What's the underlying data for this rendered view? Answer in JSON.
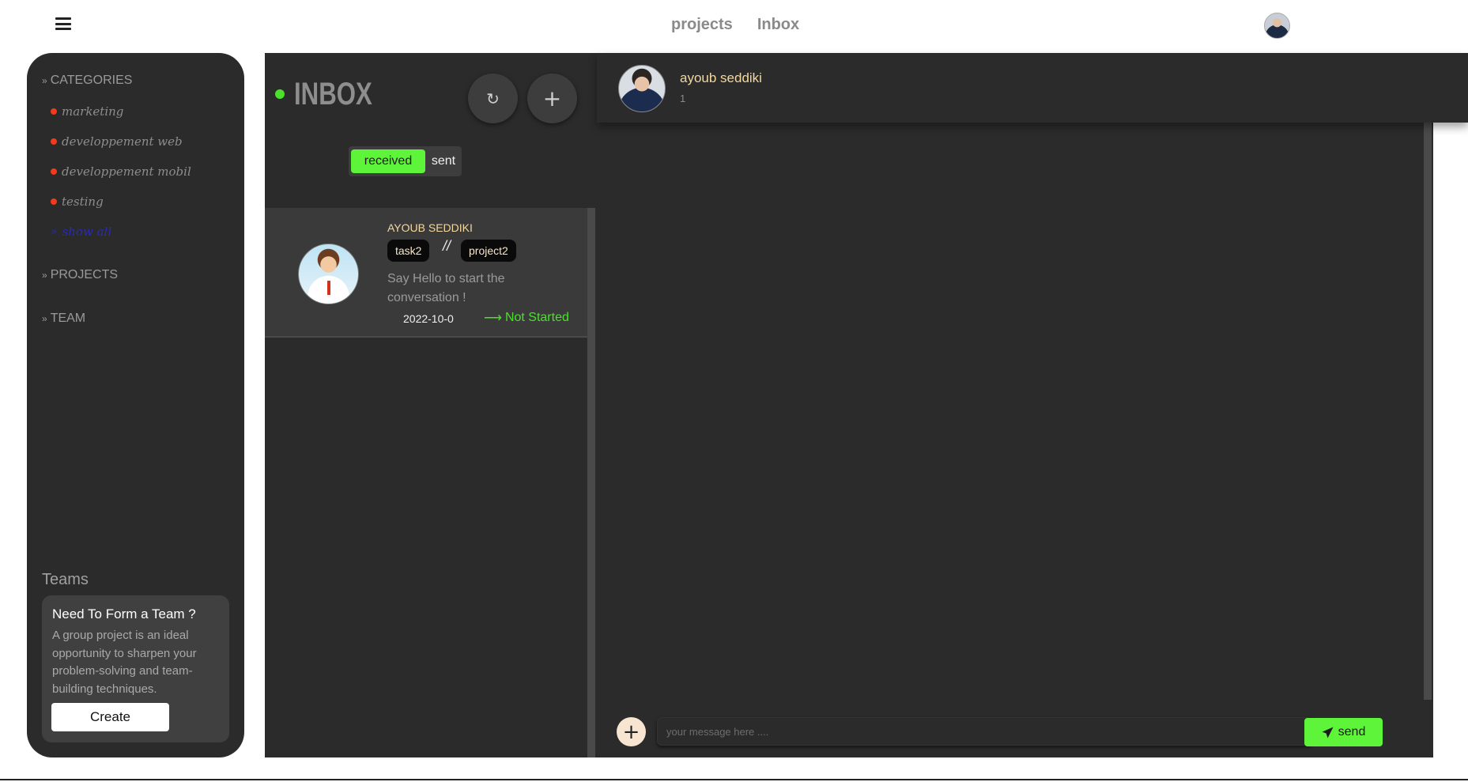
{
  "topnav": {
    "projects": "projects",
    "inbox": "Inbox"
  },
  "sidebar": {
    "categories_title": "CATEGORIES",
    "categories": [
      "marketing",
      "developpement web",
      "developpement mobil",
      "testing"
    ],
    "show_all": "show all",
    "projects_title": "PROJECTS",
    "team_title": "TEAM",
    "teams_label": "Teams",
    "team_card": {
      "title": "Need To Form a Team ?",
      "body": "A group project is an ideal opportunity to sharpen your problem-solving and team-building techniques.",
      "button": "Create"
    }
  },
  "inbox": {
    "title": "INBOX",
    "refresh_icon": "↻",
    "add_icon": "+",
    "toggle": {
      "received": "received",
      "sent": "sent"
    },
    "messages": [
      {
        "name": "AYOUB SEDDIKI",
        "task": "task2",
        "separator": "//",
        "project": "project2",
        "preview": "Say Hello to start the conversation !",
        "date": "2022-10-0",
        "status": "Not Started"
      }
    ]
  },
  "chat": {
    "name": "ayoub seddiki",
    "sub": "1",
    "input_placeholder": "your message here ....",
    "send_label": "send"
  },
  "colors": {
    "accent_green": "#5ef43a",
    "status_green": "#4be12a",
    "category_dot": "#f23a1d",
    "panel_bg": "#2b2b2b",
    "name_gold": "#f3d89e"
  }
}
